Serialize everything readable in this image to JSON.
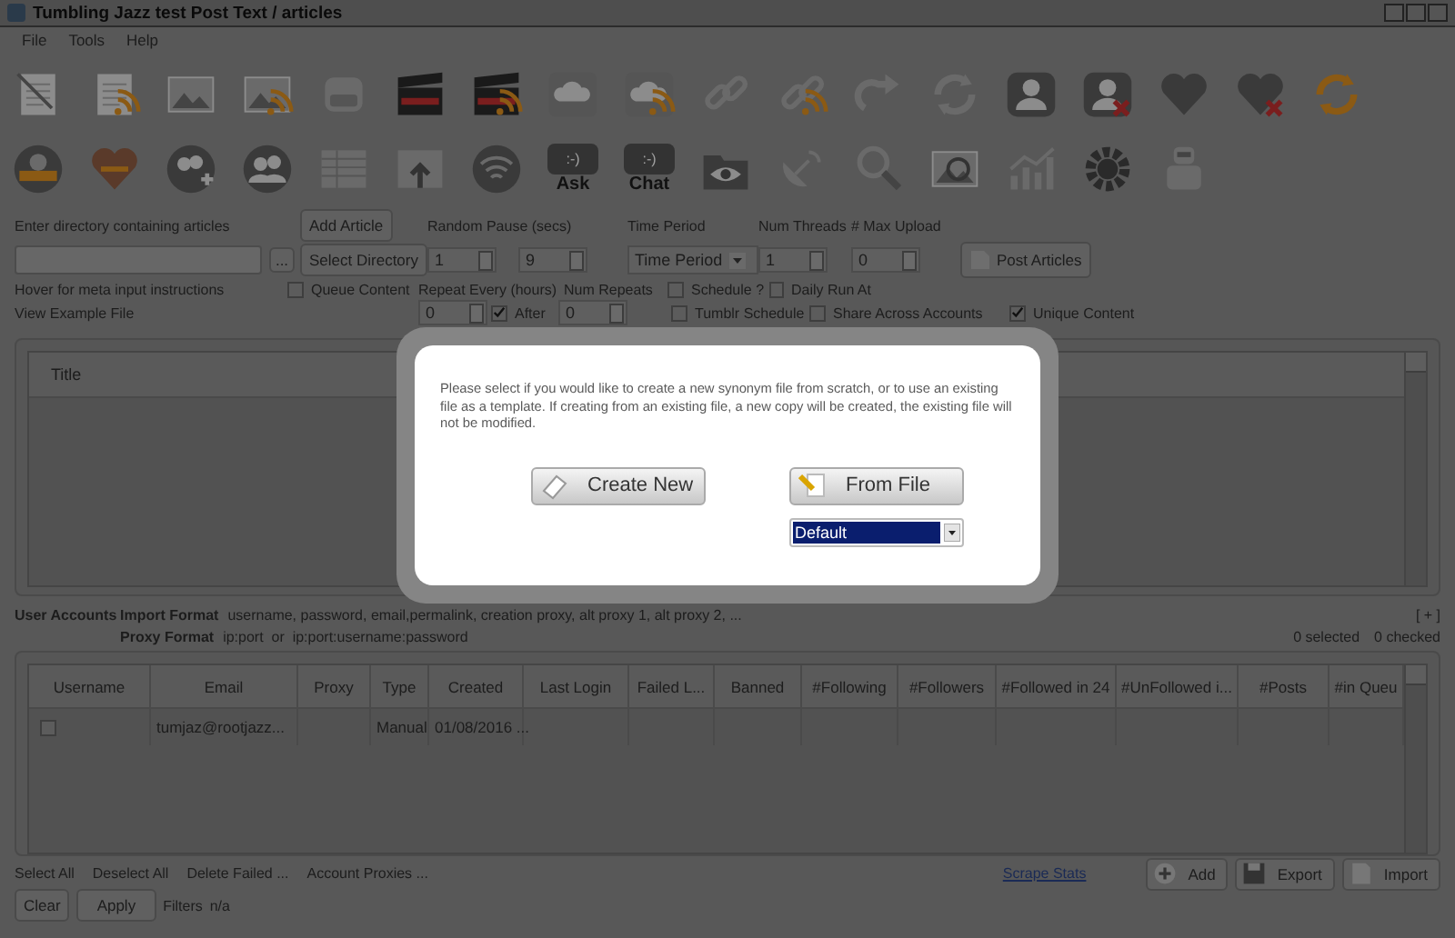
{
  "window": {
    "title": "Tumbling Jazz test Post Text / articles"
  },
  "menu": [
    "File",
    "Tools",
    "Help"
  ],
  "toolbar": {
    "bubbles": [
      {
        "icon_text": ":-)",
        "label": "Ask"
      },
      {
        "icon_text": ":-)",
        "label": "Chat"
      }
    ]
  },
  "article_form": {
    "directory_label": "Enter directory containing articles",
    "browse_button": "...",
    "hint": "Hover for meta input instructions",
    "example_link": "View Example File",
    "add_button": "Add Article",
    "select_button": "Select Directory",
    "random_pause": {
      "label": "Random Pause (secs)",
      "min": "1",
      "max": "9"
    },
    "time_period": {
      "label": "Time Period",
      "value": "Time Period"
    },
    "num_threads": {
      "label": "Num Threads",
      "value": "1"
    },
    "max_upload": {
      "label": "# Max Upload",
      "value": "0"
    },
    "post_button": "Post Articles",
    "queue_content": {
      "label": "Queue Content",
      "checked": false
    },
    "repeat_every": {
      "label": "Repeat Every (hours)",
      "value": "0"
    },
    "after": {
      "label": "After",
      "checked": true
    },
    "num_repeats": {
      "label": "Num Repeats",
      "value": "0"
    },
    "options": [
      {
        "label": "Schedule ?",
        "checked": false
      },
      {
        "label": "Daily Run At",
        "checked": false
      }
    ],
    "options_2": [
      {
        "label": "Tumblr Schedule",
        "checked": false
      },
      {
        "label": "Share Across Accounts",
        "checked": false
      },
      {
        "label": "Unique Content",
        "checked": true
      }
    ]
  },
  "articles_table": {
    "columns": [
      "Title"
    ]
  },
  "accounts": {
    "title": "User Accounts",
    "import_label": "Import Format",
    "import_value": "username, password, email,permalink, creation proxy, alt proxy 1, alt proxy 2, ...",
    "proxy_label": "Proxy Format",
    "proxy_value": "ip:port  or  ip:port:username:password",
    "expand": "[ + ]",
    "selected": "0 selected",
    "checked": "0 checked",
    "columns": [
      "Username",
      "Email",
      "Proxy",
      "Type",
      "Created",
      "Last Login",
      "Failed L...",
      "Banned",
      "#Following",
      "#Followers",
      "#Followed in 24",
      "#UnFollowed i...",
      "#Posts",
      "#in Queu"
    ],
    "rows": [
      {
        "checked": false,
        "email": "tumjaz@rootjazz...",
        "type": "Manual",
        "created": "01/08/2016 ..."
      }
    ]
  },
  "bottom": {
    "links": [
      "Select All",
      "Deselect All",
      "Delete Failed ...",
      "Account Proxies ..."
    ],
    "scrape_link": "Scrape Stats",
    "buttons": [
      "Add",
      "Export",
      "Import"
    ],
    "clear_button": "Clear",
    "apply_button": "Apply",
    "filters_label": "Filters",
    "filters_value": "n/a"
  },
  "dialog": {
    "message": "Please select if you would like to create a new synonym file from scratch, or to use an existing file as a template. If creating from an existing file, a new copy will be created, the existing file will not be modified.",
    "create_button": "Create New",
    "file_button": "From File",
    "template": "Default"
  }
}
